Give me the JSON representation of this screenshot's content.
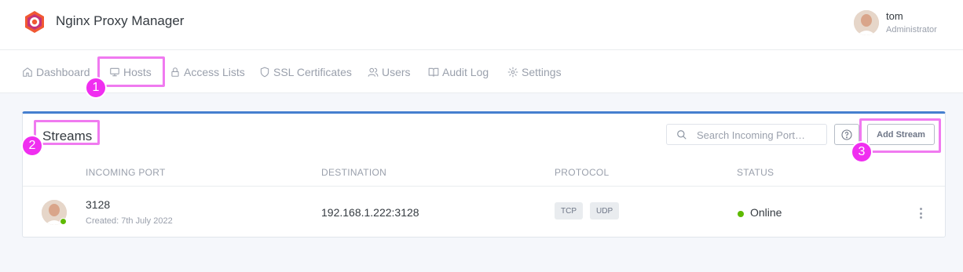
{
  "app": {
    "title": "Nginx Proxy Manager"
  },
  "user": {
    "name": "tom",
    "role": "Administrator"
  },
  "nav": {
    "items": [
      {
        "label": "Dashboard",
        "icon": "home-icon"
      },
      {
        "label": "Hosts",
        "icon": "monitor-icon"
      },
      {
        "label": "Access Lists",
        "icon": "lock-icon"
      },
      {
        "label": "SSL Certificates",
        "icon": "shield-icon"
      },
      {
        "label": "Users",
        "icon": "users-icon"
      },
      {
        "label": "Audit Log",
        "icon": "book-icon"
      },
      {
        "label": "Settings",
        "icon": "gear-icon"
      }
    ]
  },
  "streams": {
    "title": "Streams",
    "search_placeholder": "Search Incoming Port…",
    "add_label": "Add Stream",
    "columns": [
      "INCOMING PORT",
      "DESTINATION",
      "PROTOCOL",
      "STATUS"
    ],
    "rows": [
      {
        "port": "3128",
        "created": "Created: 7th July 2022",
        "destination": "192.168.1.222:3128",
        "protocols": [
          "TCP",
          "UDP"
        ],
        "status": "Online"
      }
    ]
  },
  "annotations": [
    "1",
    "2",
    "3"
  ],
  "colors": {
    "accent": "#467fcf",
    "online": "#5eba00",
    "highlight": "#f02ef0"
  }
}
